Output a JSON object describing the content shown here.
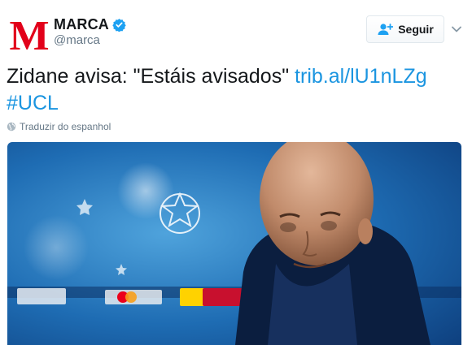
{
  "account": {
    "display_name": "MARCA",
    "handle": "@marca",
    "logo_letter": "M",
    "verified_icon": "verified-badge-icon",
    "brand_color": "#e2001a"
  },
  "follow_button": {
    "label": "Seguir",
    "icon": "add-user-icon"
  },
  "tweet": {
    "text": "Zidane avisa: \"Estáis avisados\"",
    "link": "trib.al/lU1nLZg",
    "hashtag": "#UCL",
    "link_color": "#1b95e0"
  },
  "translate": {
    "label": "Traduzir do espanhol",
    "icon": "globe-icon"
  },
  "media": {
    "description_icon": "press-conference-photo"
  }
}
